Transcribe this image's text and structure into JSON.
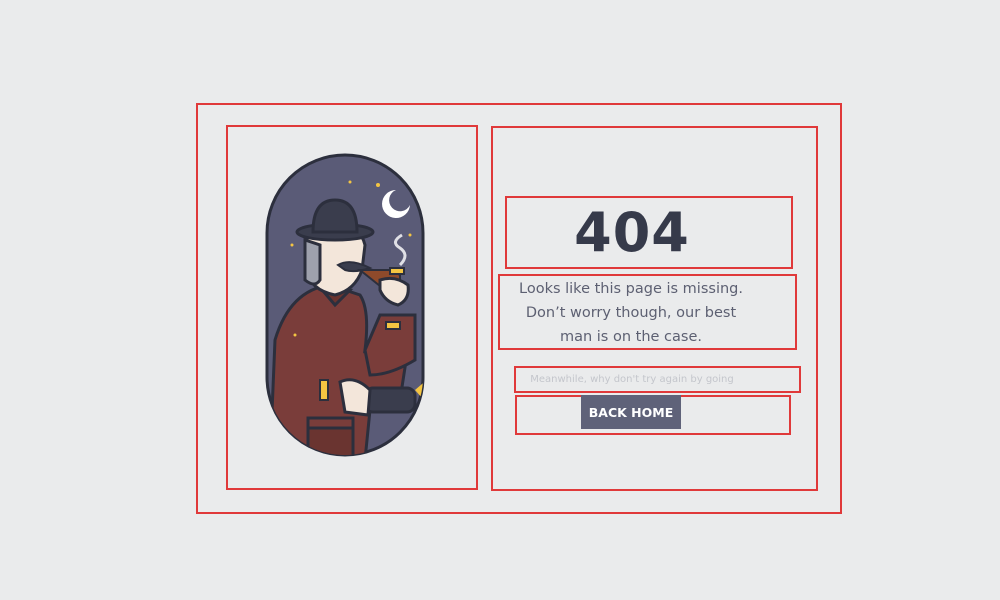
{
  "error_page": {
    "code": "404",
    "message_line1": "Looks like this page is missing.",
    "message_line2": "Don’t worry though, our best",
    "message_line3": "man is on the case.",
    "hint": "Meanwhile, why don't try again by going",
    "button_label": "BACK HOME"
  },
  "illustration": {
    "icon": "detective-with-pipe-and-flashlight",
    "moon_icon": "crescent-moon-icon",
    "star_icon": "star-icon"
  },
  "colors": {
    "background": "#eaebec",
    "heading": "#363a4a",
    "body_text": "#5d6072",
    "button": "#5f6279",
    "annotation_border": "#e0393a",
    "night_sky": "#5a5b77",
    "coat": "#7a3d3a",
    "light_beam": "#f4c542"
  }
}
